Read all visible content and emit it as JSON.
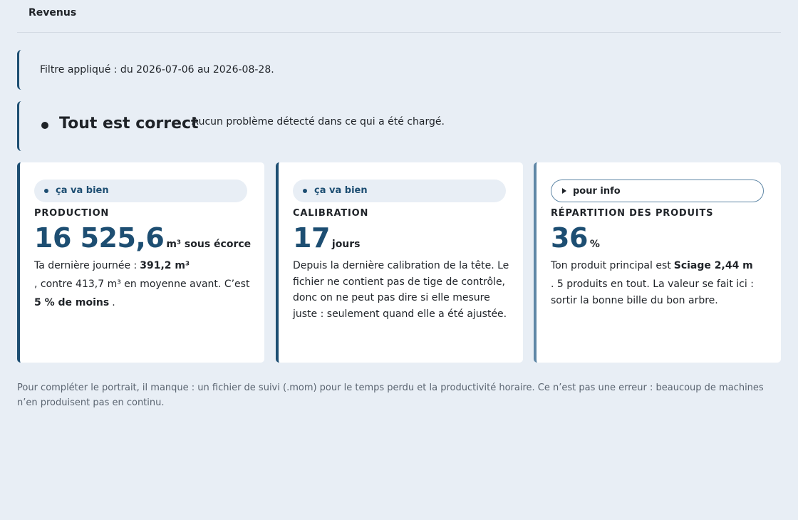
{
  "tabs": [
    {
      "label": "Revenus"
    }
  ],
  "filter_banner": {
    "text": "Filtre appliqué : du 2026-07-06 au 2026-08-28."
  },
  "status_banner": {
    "title": "Tout est correct",
    "description": "Aucun problème détecté dans ce qui a été chargé."
  },
  "cards": [
    {
      "badge": "ça va bien",
      "label": "PRODUCTION",
      "value": "16 525,6",
      "unit": "m³ sous écorce",
      "body": {
        "line1_prefix": "Ta dernière journée :",
        "line1_bold": "391,2 m³",
        "line2": ", contre 413,7 m³ en moyenne avant. C’est",
        "line3_bold": "5 % de moins",
        "line3_suffix": "."
      }
    },
    {
      "badge": "ça va bien",
      "label": "CALIBRATION",
      "value": "17",
      "unit": "jours",
      "body": {
        "text": "Depuis la dernière calibration de la tête. Le fichier ne contient pas de tige de contrôle, donc on ne peut pas dire si elle mesure juste : seulement quand elle a été ajustée."
      }
    },
    {
      "badge": "pour info",
      "label": "RÉPARTITION DES PRODUITS",
      "value": "36",
      "unit": "%",
      "body": {
        "line1_prefix": "Ton produit principal est",
        "line1_bold": "Sciage 2,44 m",
        "line2": ". 5 produits en tout. La valeur se fait ici : sortir la bonne bille du bon arbre."
      }
    }
  ],
  "footnote": "Pour compléter le portrait, il manque : un fichier de suivi (.mom) pour le temps perdu et la productivité horaire. Ce n’est pas une erreur : beaucoup de machines n’en produisent pas en continu.",
  "colors": {
    "background": "#e8eef5",
    "accent": "#1d4e72",
    "info_accent": "#5f87a6",
    "card": "#ffffff"
  },
  "icons": {
    "status": "bullet-dot-icon",
    "ok_badge": "dot-icon",
    "info_badge": "triangle-right-icon"
  }
}
